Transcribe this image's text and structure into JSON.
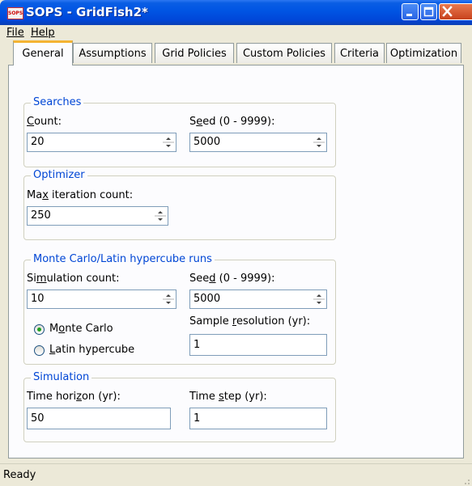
{
  "window": {
    "title": "SOPS - GridFish2*",
    "icon_label": "SOPS"
  },
  "menu": {
    "file": "File",
    "help": "Help"
  },
  "tabs": [
    "General",
    "Assumptions",
    "Grid Policies",
    "Custom Policies",
    "Criteria",
    "Optimization"
  ],
  "searches": {
    "title": "Searches",
    "count_label_u": "C",
    "count_label_rest": "ount:",
    "count_value": "20",
    "seed_label_a": "S",
    "seed_label_u": "e",
    "seed_label_rest": "ed (0 - 9999):",
    "seed_value": "5000"
  },
  "optimizer": {
    "title": "Optimizer",
    "max_label_a": "Ma",
    "max_label_u": "x",
    "max_label_rest": " iteration count:",
    "max_value": "250"
  },
  "montecarlo": {
    "title": "Monte Carlo/Latin hypercube runs",
    "sim_label_a": "Si",
    "sim_label_u": "m",
    "sim_label_rest": "ulation count:",
    "sim_value": "10",
    "seed_label_a": "See",
    "seed_label_u": "d",
    "seed_label_rest": " (0 - 9999):",
    "seed_value": "5000",
    "radio_mc_a": "M",
    "radio_mc_u": "o",
    "radio_mc_rest": "nte Carlo",
    "radio_lh_u": "L",
    "radio_lh_rest": "atin hypercube",
    "selected": "Monte Carlo",
    "res_label_a": "Sample ",
    "res_label_u": "r",
    "res_label_rest": "esolution (yr):",
    "res_value": "1"
  },
  "simulation": {
    "title": "Simulation",
    "horizon_label_a": "Time hori",
    "horizon_label_u": "z",
    "horizon_label_rest": "on (yr):",
    "horizon_value": "50",
    "step_label_a": "Time ",
    "step_label_u": "s",
    "step_label_rest": "tep (yr):",
    "step_value": "1"
  },
  "status": {
    "text": "Ready"
  }
}
